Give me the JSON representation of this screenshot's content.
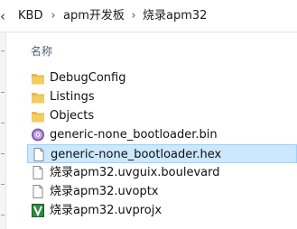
{
  "address_bar": {
    "crumbs": [
      "KBD",
      "apm开发板",
      "烧录apm32"
    ],
    "separator": "›"
  },
  "columns": {
    "name_header": "名称"
  },
  "files": [
    {
      "name": "DebugConfig",
      "icon": "folder-icon",
      "selected": false
    },
    {
      "name": "Listings",
      "icon": "folder-icon",
      "selected": false
    },
    {
      "name": "Objects",
      "icon": "folder-icon",
      "selected": false
    },
    {
      "name": "generic-none_bootloader.bin",
      "icon": "disc-image-icon",
      "selected": false
    },
    {
      "name": "generic-none_bootloader.hex",
      "icon": "file-icon",
      "selected": true
    },
    {
      "name": "烧录apm32.uvguix.boulevard",
      "icon": "file-icon",
      "selected": false
    },
    {
      "name": "烧录apm32.uvoptx",
      "icon": "file-icon",
      "selected": false
    },
    {
      "name": "烧录apm32.uvprojx",
      "icon": "keil-project-icon",
      "selected": false
    }
  ],
  "colors": {
    "selection_fill": "#cce8ff",
    "selection_border": "#99d1ff",
    "folder": "#e8b84a",
    "header_text": "#4c607a"
  }
}
